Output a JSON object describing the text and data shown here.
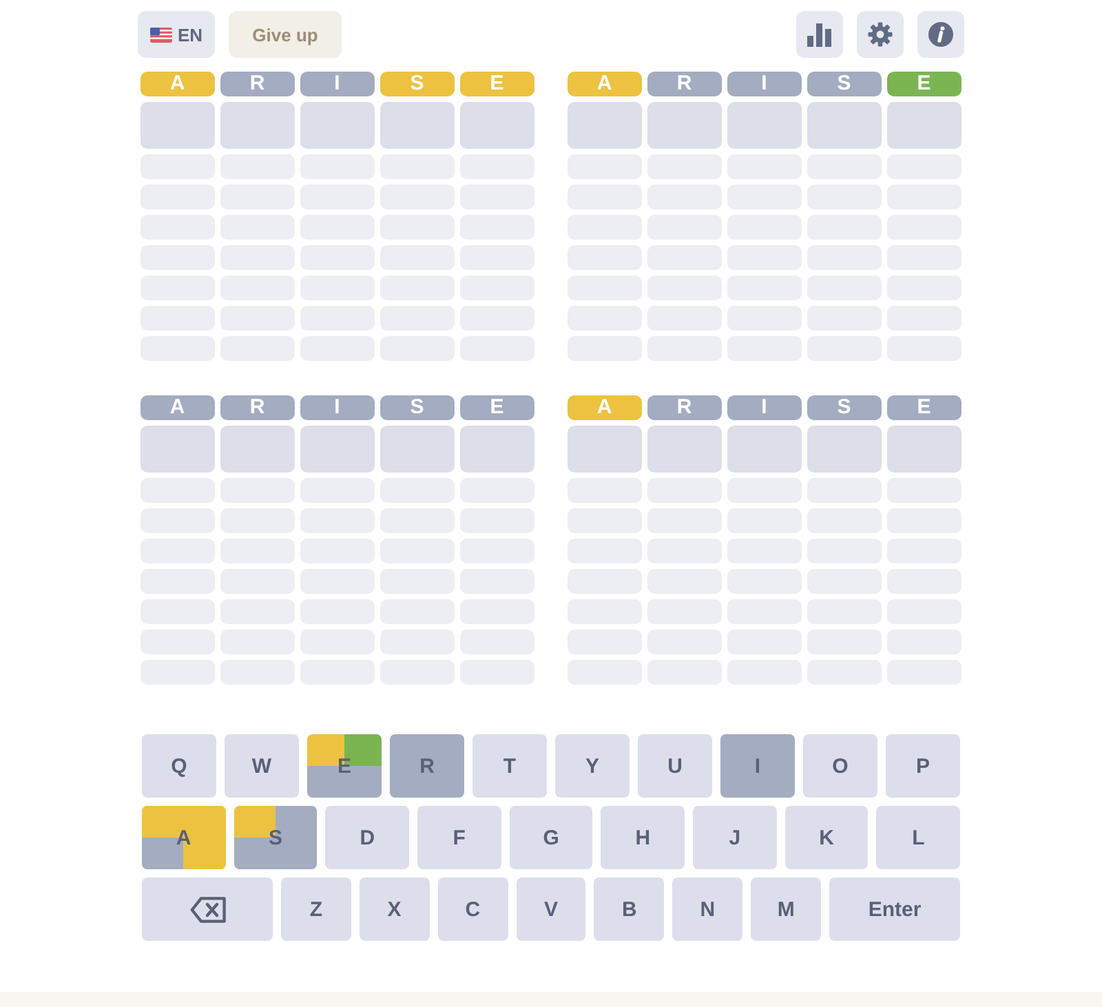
{
  "toolbar": {
    "language": {
      "code": "EN"
    },
    "give_up": {
      "label": "Give up"
    }
  },
  "boards": [
    {
      "rows": [
        {
          "kind": "guess",
          "tiles": [
            {
              "letter": "A",
              "color": "#ecc240"
            },
            {
              "letter": "R",
              "color": "#a3acc0"
            },
            {
              "letter": "I",
              "color": "#a3acc0"
            },
            {
              "letter": "S",
              "color": "#ecc240"
            },
            {
              "letter": "E",
              "color": "#ecc240"
            }
          ]
        },
        {
          "kind": "input"
        },
        {
          "kind": "empty"
        },
        {
          "kind": "empty"
        },
        {
          "kind": "empty"
        },
        {
          "kind": "empty"
        },
        {
          "kind": "empty"
        },
        {
          "kind": "empty"
        },
        {
          "kind": "empty"
        }
      ]
    },
    {
      "rows": [
        {
          "kind": "guess",
          "tiles": [
            {
              "letter": "A",
              "color": "#ecc240"
            },
            {
              "letter": "R",
              "color": "#a3acc0"
            },
            {
              "letter": "I",
              "color": "#a3acc0"
            },
            {
              "letter": "S",
              "color": "#a3acc0"
            },
            {
              "letter": "E",
              "color": "#7bb551"
            }
          ]
        },
        {
          "kind": "input"
        },
        {
          "kind": "empty"
        },
        {
          "kind": "empty"
        },
        {
          "kind": "empty"
        },
        {
          "kind": "empty"
        },
        {
          "kind": "empty"
        },
        {
          "kind": "empty"
        },
        {
          "kind": "empty"
        }
      ]
    },
    {
      "rows": [
        {
          "kind": "guess",
          "tiles": [
            {
              "letter": "A",
              "color": "#a3acc0"
            },
            {
              "letter": "R",
              "color": "#a3acc0"
            },
            {
              "letter": "I",
              "color": "#a3acc0"
            },
            {
              "letter": "S",
              "color": "#a3acc0"
            },
            {
              "letter": "E",
              "color": "#a3acc0"
            }
          ]
        },
        {
          "kind": "input"
        },
        {
          "kind": "empty"
        },
        {
          "kind": "empty"
        },
        {
          "kind": "empty"
        },
        {
          "kind": "empty"
        },
        {
          "kind": "empty"
        },
        {
          "kind": "empty"
        },
        {
          "kind": "empty"
        }
      ]
    },
    {
      "rows": [
        {
          "kind": "guess",
          "tiles": [
            {
              "letter": "A",
              "color": "#ecc240"
            },
            {
              "letter": "R",
              "color": "#a3acc0"
            },
            {
              "letter": "I",
              "color": "#a3acc0"
            },
            {
              "letter": "S",
              "color": "#a3acc0"
            },
            {
              "letter": "E",
              "color": "#a3acc0"
            }
          ]
        },
        {
          "kind": "input"
        },
        {
          "kind": "empty"
        },
        {
          "kind": "empty"
        },
        {
          "kind": "empty"
        },
        {
          "kind": "empty"
        },
        {
          "kind": "empty"
        },
        {
          "kind": "empty"
        },
        {
          "kind": "empty"
        }
      ]
    }
  ],
  "keyboard": {
    "rows": [
      {
        "keys": [
          {
            "kind": "letter",
            "label": "Q"
          },
          {
            "kind": "letter",
            "label": "W"
          },
          {
            "kind": "letter",
            "label": "E",
            "quadrants": [
              {
                "color": "#ecc240"
              },
              {
                "color": "#7bb551"
              },
              {
                "color": "#a3acc0"
              },
              {
                "color": "#a3acc0"
              }
            ]
          },
          {
            "kind": "letter",
            "label": "R",
            "quadrants": [
              {
                "color": "#a3acc0"
              },
              {
                "color": "#a3acc0"
              },
              {
                "color": "#a3acc0"
              },
              {
                "color": "#a3acc0"
              }
            ]
          },
          {
            "kind": "letter",
            "label": "T"
          },
          {
            "kind": "letter",
            "label": "Y"
          },
          {
            "kind": "letter",
            "label": "U"
          },
          {
            "kind": "letter",
            "label": "I",
            "quadrants": [
              {
                "color": "#a3acc0"
              },
              {
                "color": "#a3acc0"
              },
              {
                "color": "#a3acc0"
              },
              {
                "color": "#a3acc0"
              }
            ]
          },
          {
            "kind": "letter",
            "label": "O"
          },
          {
            "kind": "letter",
            "label": "P"
          }
        ]
      },
      {
        "keys": [
          {
            "kind": "letter",
            "label": "A",
            "quadrants": [
              {
                "color": "#ecc240"
              },
              {
                "color": "#ecc240"
              },
              {
                "color": "#a3acc0"
              },
              {
                "color": "#ecc240"
              }
            ]
          },
          {
            "kind": "letter",
            "label": "S",
            "quadrants": [
              {
                "color": "#ecc240"
              },
              {
                "color": "#a3acc0"
              },
              {
                "color": "#a3acc0"
              },
              {
                "color": "#a3acc0"
              }
            ]
          },
          {
            "kind": "letter",
            "label": "D"
          },
          {
            "kind": "letter",
            "label": "F"
          },
          {
            "kind": "letter",
            "label": "G"
          },
          {
            "kind": "letter",
            "label": "H"
          },
          {
            "kind": "letter",
            "label": "J"
          },
          {
            "kind": "letter",
            "label": "K"
          },
          {
            "kind": "letter",
            "label": "L"
          }
        ]
      },
      {
        "keys": [
          {
            "kind": "backspace"
          },
          {
            "kind": "letter",
            "label": "Z"
          },
          {
            "kind": "letter",
            "label": "X"
          },
          {
            "kind": "letter",
            "label": "C"
          },
          {
            "kind": "letter",
            "label": "V"
          },
          {
            "kind": "letter",
            "label": "B"
          },
          {
            "kind": "letter",
            "label": "N"
          },
          {
            "kind": "letter",
            "label": "M"
          },
          {
            "kind": "enter",
            "label": "Enter"
          }
        ]
      }
    ]
  }
}
